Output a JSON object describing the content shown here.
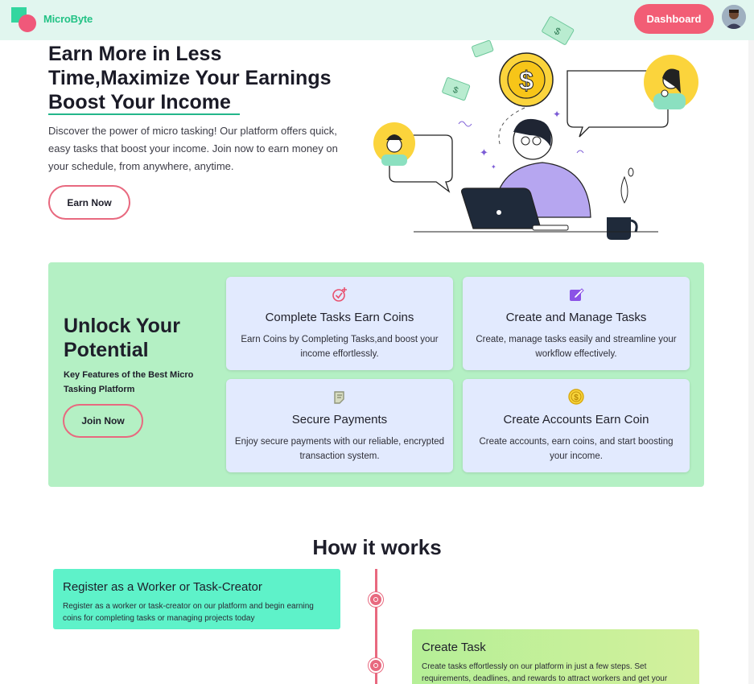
{
  "header": {
    "brand": "MicroByte",
    "dashboard_label": "Dashboard",
    "avatar_icon": "user-avatar"
  },
  "hero": {
    "title_line1": "Earn More in Less",
    "title_line2": "Time,Maximize Your Earnings",
    "title_line3": "Boost Your Income",
    "description": "Discover the power of micro tasking! Our platform offers quick, easy tasks that boost your income. Join now to earn money on your schedule, from anywhere, anytime.",
    "cta_label": "Earn Now"
  },
  "features": {
    "title": "Unlock Your Potential",
    "subtitle": "Key Features of the Best Micro Tasking Platform",
    "cta_label": "Join Now",
    "cards": [
      {
        "icon": "check-plus-icon",
        "title": "Complete Tasks Earn Coins",
        "description": "Earn Coins by Completing Tasks,and boost your income effortlessly."
      },
      {
        "icon": "edit-icon",
        "title": "Create and Manage Tasks",
        "description": "Create, manage tasks easily and streamline your workflow effectively."
      },
      {
        "icon": "payment-icon",
        "title": "Secure Payments",
        "description": "Enjoy secure payments with our reliable, encrypted transaction system."
      },
      {
        "icon": "coin-icon",
        "title": "Create Accounts Earn Coin",
        "description": "Create accounts, earn coins, and start boosting your income."
      }
    ]
  },
  "how_it_works": {
    "title": "How it works",
    "steps": [
      {
        "title": "Register as a Worker or Task-Creator",
        "description": "Register as a worker or task-creator on our platform and begin earning coins for completing tasks or managing projects today"
      },
      {
        "title": "Create Task",
        "description": "Create tasks effortlessly on our platform in just a few steps. Set requirements, deadlines, and rewards to attract workers and get your"
      }
    ]
  },
  "colors": {
    "brand": "#22c285",
    "accent": "#f25d75",
    "header_bg": "#e1f6ef",
    "features_bg": "#b4f0c4",
    "card_bg": "#e2eafe",
    "step1_bg": "#5ef2c9",
    "step2_bg": "#c4f09a"
  }
}
